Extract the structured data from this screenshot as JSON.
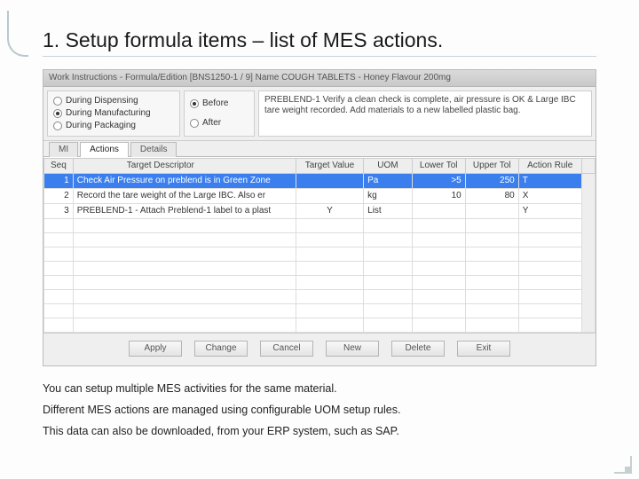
{
  "title": "1. Setup formula items – list of MES actions.",
  "window": {
    "titlebar": "Work Instructions - Formula/Edition [BNS1250-1 / 9]   Name  COUGH TABLETS - Honey Flavour 200mg"
  },
  "phase": {
    "opt1": "During Dispensing",
    "opt2": "During Manufacturing",
    "opt3": "During Packaging"
  },
  "when": {
    "opt1": "Before",
    "opt2": "After"
  },
  "desc": "PREBLEND-1 Verify a clean check is complete, air pressure is OK & Large IBC tare weight recorded. Add materials to a new labelled plastic bag.",
  "tabs": {
    "t1": "MI",
    "t2": "Actions",
    "t3": "Details"
  },
  "columns": {
    "c1": "Seq",
    "c2": "Target Descriptor",
    "c3": "Target Value",
    "c4": "UOM",
    "c5": "Lower Tol",
    "c6": "Upper Tol",
    "c7": "Action Rule"
  },
  "rows": [
    {
      "seq": "1",
      "desc": "Check Air Pressure on preblend is in Green Zone",
      "tv": "",
      "uom": "Pa",
      "lo": ">5",
      "hi": "250",
      "rule": "T"
    },
    {
      "seq": "2",
      "desc": "Record the tare weight of the Large IBC. Also er",
      "tv": "",
      "uom": "kg",
      "lo": "10",
      "hi": "80",
      "rule": "X"
    },
    {
      "seq": "3",
      "desc": "PREBLEND-1 - Attach Preblend-1 label to a plast",
      "tv": "Y",
      "uom": "List",
      "lo": "",
      "hi": "",
      "rule": "Y"
    }
  ],
  "buttons": {
    "b1": "Apply",
    "b2": "Change",
    "b3": "Cancel",
    "b4": "New",
    "b5": "Delete",
    "b6": "Exit"
  },
  "notes": {
    "n1": "You can setup multiple MES activities for the same material.",
    "n2": "Different MES actions are managed using configurable UOM setup rules.",
    "n3": "This data can also be downloaded, from your ERP system, such as SAP."
  }
}
